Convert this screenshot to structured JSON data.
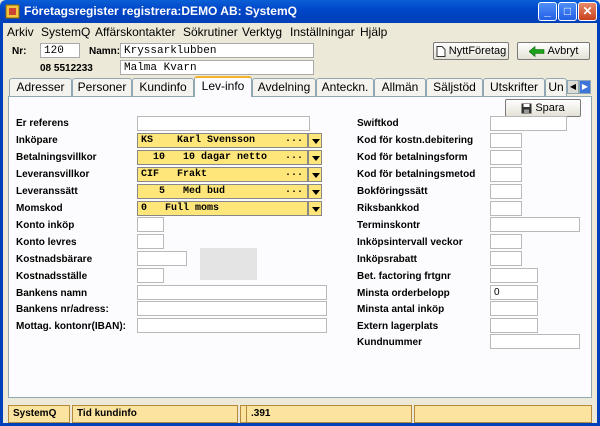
{
  "window": {
    "title": "Företagsregister registrera:DEMO AB: SystemQ",
    "minimize": "_",
    "maximize": "□",
    "close": "✕"
  },
  "menu": [
    "Arkiv",
    "SystemQ",
    "Affärskontakter",
    "Sökrutiner",
    "Verktyg",
    "Inställningar",
    "Hjälp"
  ],
  "header": {
    "nr_label": "Nr:",
    "nr_value": "120",
    "namn_label": "Namn:",
    "namn_value": "Kryssarklubben",
    "phone": "08 5512233",
    "address": "Malma Kvarn",
    "new_company_button": "NyttFöretag",
    "cancel_button": "Avbryt"
  },
  "tabs": [
    "Adresser",
    "Personer",
    "Kundinfo",
    "Lev-info",
    "Avdelning",
    "Anteckn.",
    "Allmän",
    "Säljstöd",
    "Utskrifter",
    "Un"
  ],
  "active_tab": "Lev-info",
  "save_button": "Spara",
  "left_fields": {
    "er_referens": {
      "label": "Er referens",
      "value": ""
    },
    "inkopare": {
      "label": "Inköpare",
      "code": "KS",
      "value": "Karl Svensson",
      "dots": "..."
    },
    "betalningsvillkor": {
      "label": "Betalningsvillkor",
      "code": "10",
      "value": "10 dagar netto",
      "dots": "..."
    },
    "leveransvillkor": {
      "label": "Leveransvillkor",
      "code": "CIF",
      "value": "Frakt",
      "dots": "..."
    },
    "leveranssatt": {
      "label": "Leveranssätt",
      "code": "5",
      "value": "Med bud",
      "dots": "..."
    },
    "momskod": {
      "label": "Momskod",
      "code": "0",
      "value": "Full moms"
    },
    "konto_inkop": {
      "label": "Konto inköp",
      "value": ""
    },
    "konto_levres": {
      "label": "Konto levres",
      "value": ""
    },
    "kostnadsbarare": {
      "label": "Kostnadsbärare",
      "value": ""
    },
    "kostnadsstalle": {
      "label": "Kostnadsställe",
      "value": ""
    },
    "bankens_namn": {
      "label": "Bankens namn",
      "value": ""
    },
    "bankens_nr": {
      "label": "Bankens nr/adress:",
      "value": ""
    },
    "mottag_kontonr": {
      "label": "Mottag. kontonr(IBAN):",
      "value": ""
    }
  },
  "right_fields": {
    "swiftkod": {
      "label": "Swiftkod",
      "value": ""
    },
    "kod_kostn": {
      "label": "Kod för kostn.debitering",
      "value": ""
    },
    "kod_betform": {
      "label": "Kod för betalningsform",
      "value": ""
    },
    "kod_betmetod": {
      "label": "Kod för betalningsmetod",
      "value": ""
    },
    "bokforingssatt": {
      "label": "Bokföringssätt",
      "value": ""
    },
    "riksbankkod": {
      "label": "Riksbankkod",
      "value": ""
    },
    "terminskontr": {
      "label": "Terminskontr",
      "value": ""
    },
    "inkopsintervall": {
      "label": "Inköpsintervall veckor",
      "value": ""
    },
    "inkopsrabatt": {
      "label": "Inköpsrabatt",
      "value": ""
    },
    "bet_factoring": {
      "label": "Bet. factoring frtgnr",
      "value": ""
    },
    "minsta_orderbelopp": {
      "label": "Minsta orderbelopp",
      "value": "0"
    },
    "minsta_antal": {
      "label": "Minsta antal inköp",
      "value": ""
    },
    "extern_lagerplats": {
      "label": "Extern lagerplats",
      "value": ""
    },
    "kundnummer": {
      "label": "Kundnummer",
      "value": ""
    }
  },
  "statusbar": [
    "SystemQ",
    "Tid kundinfo",
    "",
    ".391",
    ""
  ],
  "colors": {
    "titlebar": "#0046c8",
    "combo_bg": "#ffe67a",
    "status_bg": "#fce3a0",
    "active_tab_accent": "#f2b22c"
  }
}
